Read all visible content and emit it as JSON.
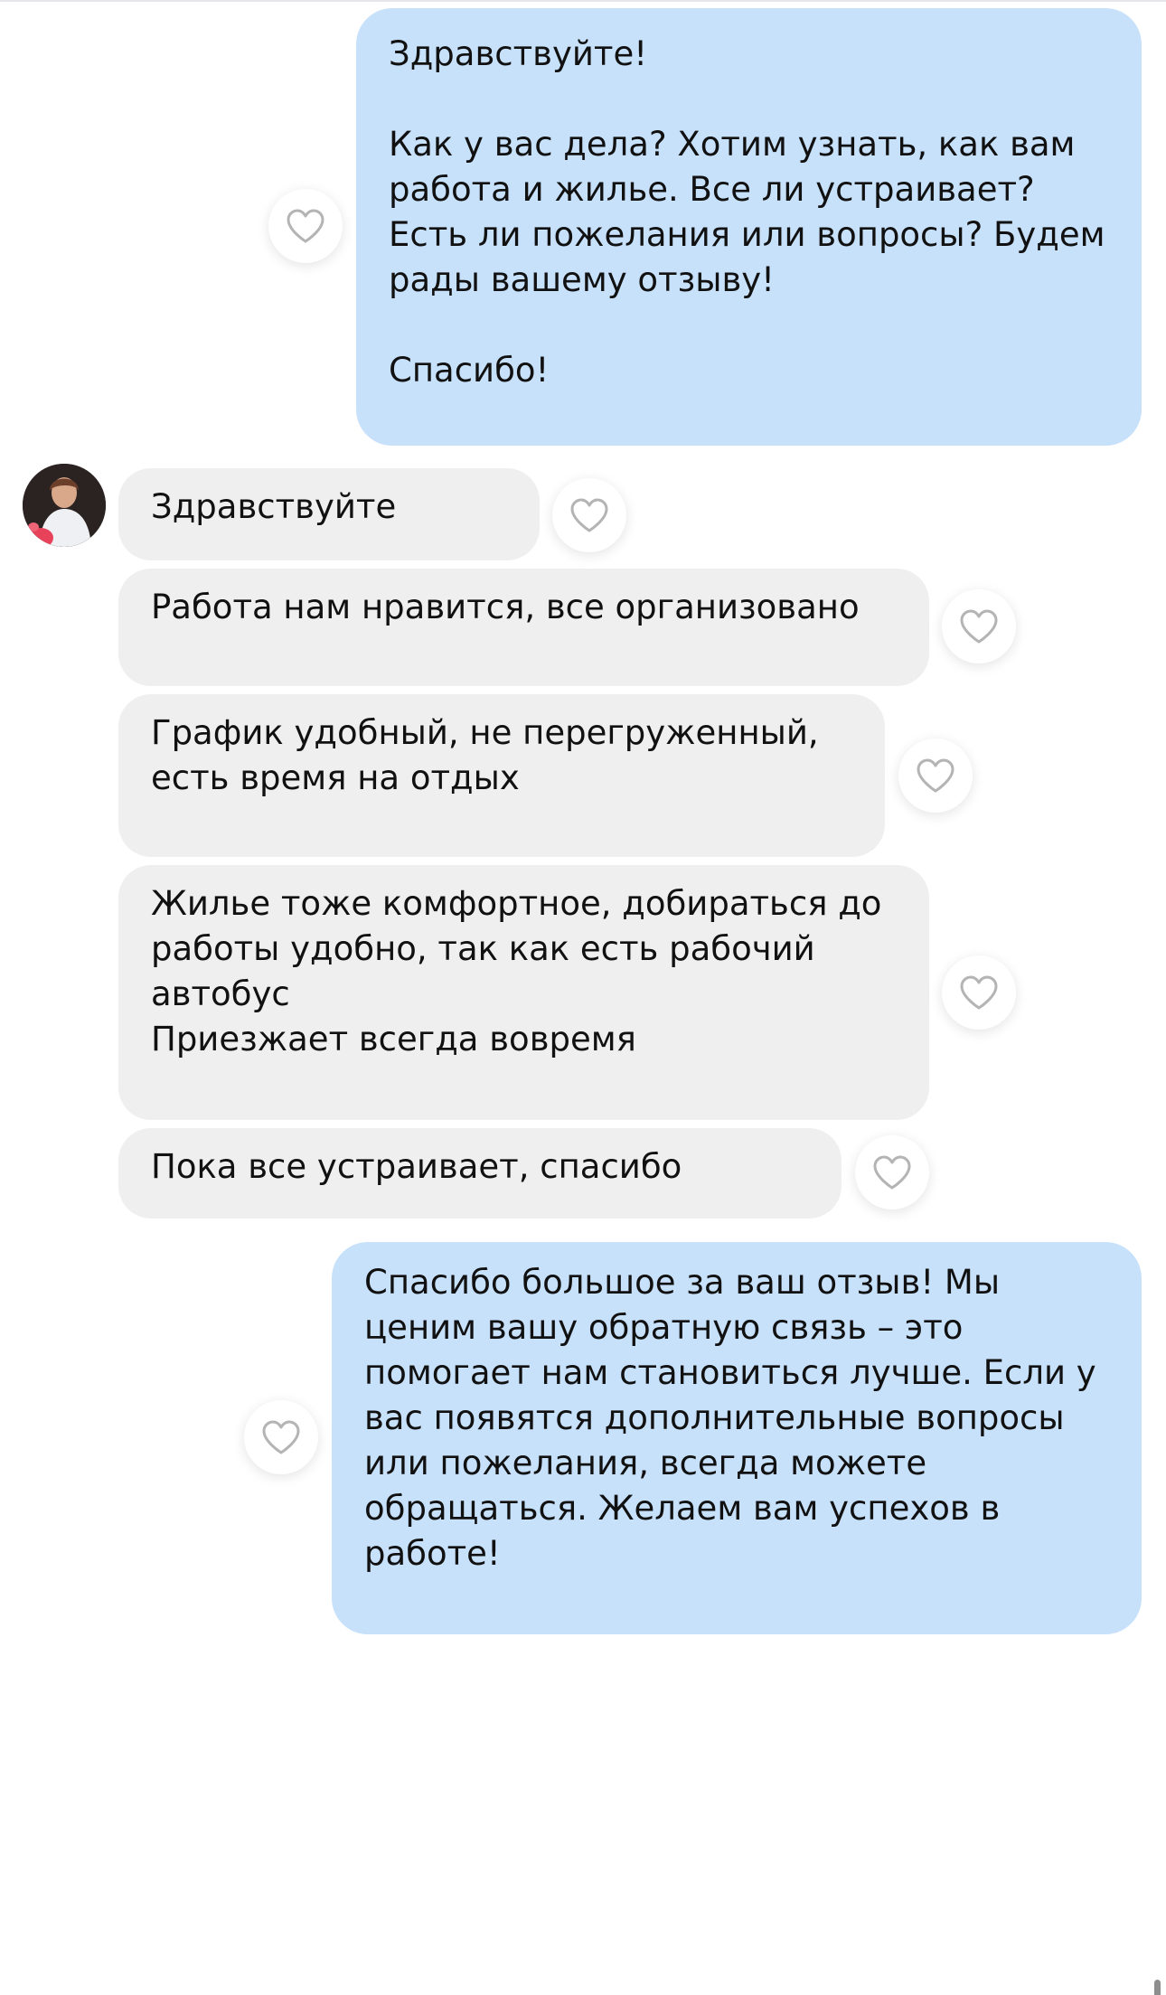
{
  "thread": {
    "messages": [
      {
        "direction": "outgoing",
        "text": "Здравствуйте!\n\nКак у вас дела? Хотим узнать, как вам работа и жилье. Все ли устраивает? Есть ли пожелания или вопросы? Будем рады вашему отзыву!\n\nСпасибо!",
        "reaction_icon": "heart-outline-icon"
      },
      {
        "direction": "incoming",
        "text": "Здравствуйте",
        "reaction_icon": "heart-outline-icon"
      },
      {
        "direction": "incoming",
        "text": "Работа нам нравится, все организовано",
        "reaction_icon": "heart-outline-icon"
      },
      {
        "direction": "incoming",
        "text": "График удобный, не перегруженный, есть время на отдых",
        "reaction_icon": "heart-outline-icon"
      },
      {
        "direction": "incoming",
        "text": "Жилье тоже комфортное, добираться до работы удобно, так как есть рабочий автобус\nПриезжает всегда вовремя",
        "reaction_icon": "heart-outline-icon"
      },
      {
        "direction": "incoming",
        "text": "Пока все устраивает, спасибо",
        "reaction_icon": "heart-outline-icon"
      },
      {
        "direction": "outgoing",
        "text": "Спасибо большое за ваш отзыв! Мы ценим вашу обратную связь – это помогает нам становиться лучше. Если у вас появятся дополнительные вопросы или пожелания, всегда можете обращаться. Желаем вам успехов в работе!",
        "reaction_icon": "heart-outline-icon"
      }
    ]
  },
  "colors": {
    "outgoing_bubble": "#c8e1fb",
    "incoming_bubble": "#efefef",
    "background": "#ffffff",
    "heart_stroke": "#b4b4b4"
  }
}
